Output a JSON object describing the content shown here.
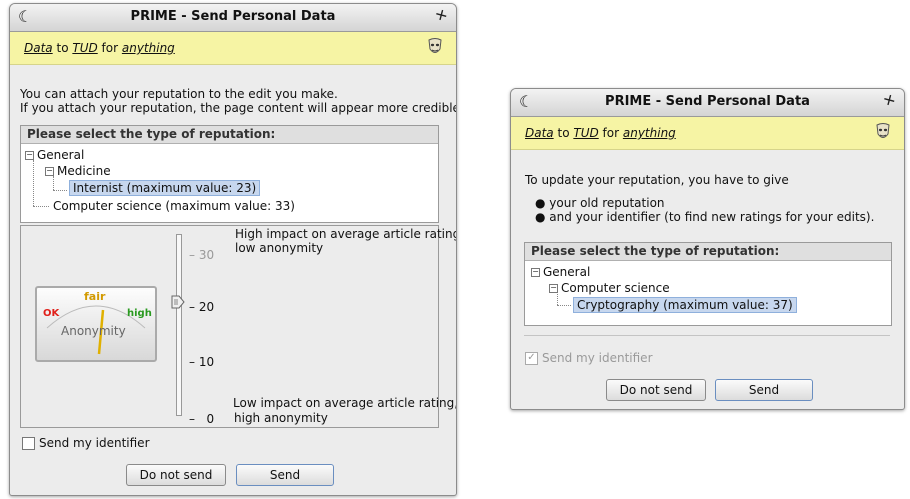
{
  "window1": {
    "title": "PRIME - Send Personal Data",
    "banner": {
      "data": "Data",
      "to": "to",
      "recipient": "TUD",
      "for": "for",
      "purpose": "anything"
    },
    "intro_line1": "You can attach your reputation to the edit you make.",
    "intro_line2": "If you attach your reputation, the page content will appear more credible.",
    "panel_header": "Please select the type of reputation:",
    "tree": {
      "root": "General",
      "child": "Medicine",
      "selected_leaf": "Internist (maximum value: 23)",
      "sibling": "Computer science (maximum value: 33)"
    },
    "slider": {
      "ticks": [
        "30",
        "20",
        "10",
        "0"
      ],
      "value": 20,
      "max": 30,
      "high_label_line1": "High impact on average article rating,",
      "high_label_line2": "low anonymity",
      "low_label_line1": "Low impact on average article rating,",
      "low_label_line2": "high anonymity"
    },
    "gauge": {
      "ok": "OK",
      "fair": "fair",
      "high": "high",
      "label": "Anonymity"
    },
    "identifier_checkbox": {
      "label": "Send my identifier",
      "checked": false
    },
    "buttons": {
      "do_not_send": "Do not send",
      "send": "Send"
    }
  },
  "window2": {
    "title": "PRIME - Send Personal Data",
    "banner": {
      "data": "Data",
      "to": "to",
      "recipient": "TUD",
      "for": "for",
      "purpose": "anything"
    },
    "intro": "To update your reputation, you have to give",
    "bullets": [
      "your old reputation",
      "and your identifier (to find new ratings for your edits)."
    ],
    "panel_header": "Please select the type of reputation:",
    "tree": {
      "root": "General",
      "child": "Computer science",
      "selected_leaf": "Cryptography (maximum value: 37)"
    },
    "identifier_checkbox": {
      "label": "Send my identifier",
      "checked": true,
      "disabled": true
    },
    "buttons": {
      "do_not_send": "Do not send",
      "send": "Send"
    }
  },
  "colors": {
    "banner": "#f6f4a4",
    "selection": "#c7d7ee",
    "window_bg": "#ececec"
  }
}
